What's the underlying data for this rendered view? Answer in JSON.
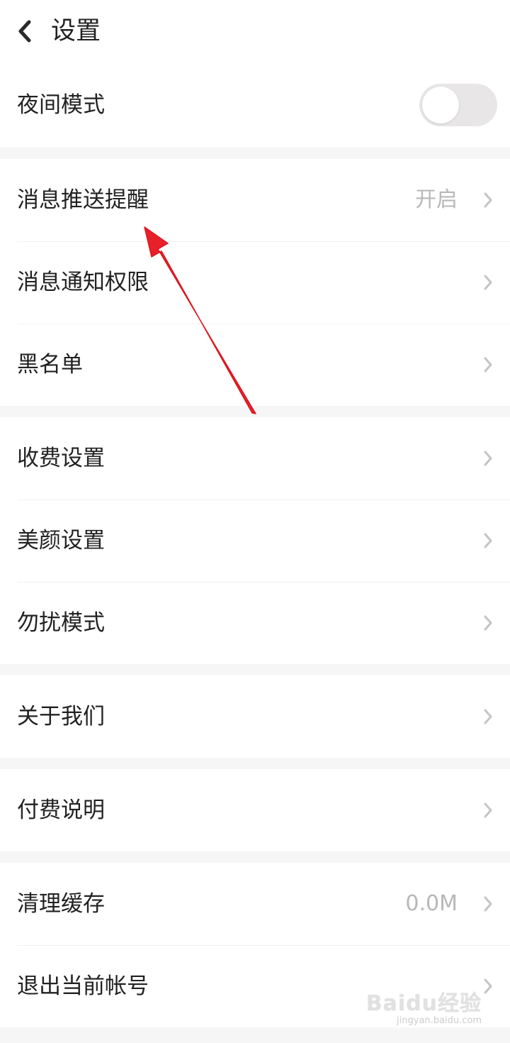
{
  "header": {
    "title": "设置",
    "back_icon": "chevron-left-icon"
  },
  "sections": [
    {
      "items": [
        {
          "label": "夜间模式",
          "control": "toggle",
          "toggle_on": false
        }
      ]
    },
    {
      "items": [
        {
          "label": "消息推送提醒",
          "value": "开启"
        },
        {
          "label": "消息通知权限"
        },
        {
          "label": "黑名单"
        }
      ]
    },
    {
      "items": [
        {
          "label": "收费设置"
        },
        {
          "label": "美颜设置"
        },
        {
          "label": "勿扰模式"
        }
      ]
    },
    {
      "items": [
        {
          "label": "关于我们"
        }
      ]
    },
    {
      "items": [
        {
          "label": "付费说明"
        }
      ]
    },
    {
      "items": [
        {
          "label": "清理缓存",
          "value": "0.0M"
        },
        {
          "label": "退出当前帐号"
        }
      ]
    }
  ],
  "annotation": {
    "type": "arrow",
    "color": "#e8202a"
  },
  "watermark": {
    "logo": "Baidu经验",
    "sub": "jingyan.baidu.com"
  },
  "colors": {
    "background": "#f6f6f6",
    "row": "#ffffff",
    "text": "#222222",
    "secondary_text": "#b8b8b8",
    "chevron": "#c4c4c4",
    "toggle_off": "#e8e6e6"
  }
}
